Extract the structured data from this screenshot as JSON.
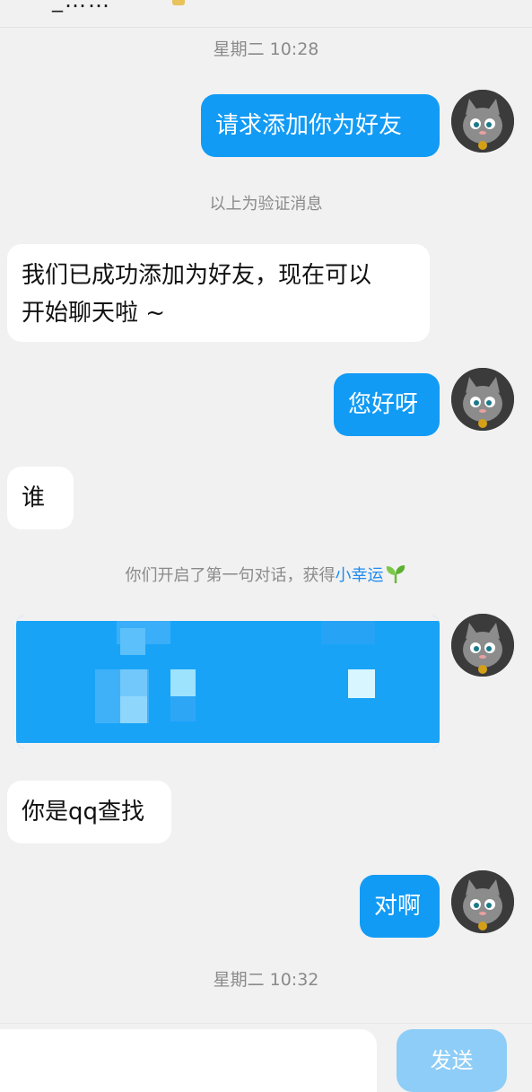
{
  "header": {
    "partial_title": "_……"
  },
  "timestamps": {
    "first": "星期二 10:28",
    "second": "星期二 10:32"
  },
  "system_notices": {
    "verify": "以上为验证消息",
    "first_chat_prefix": "你们开启了第一句对话，获得",
    "first_chat_link": "小幸运"
  },
  "messages": {
    "m1": "请求添加你为好友",
    "m2_line1": "我们已成功添加为好友，现在可以",
    "m2_line2": "开始聊天啦 ~",
    "m3": "您好呀",
    "m4": "谁",
    "m6": "你是qq查找",
    "m7": "对啊"
  },
  "input_bar": {
    "send_label": "发送"
  },
  "icons": {
    "avatar": "cat-avatar-icon",
    "leaf": "sprout-icon"
  },
  "colors": {
    "outgoing_bubble": "#129bf5",
    "incoming_bubble": "#ffffff",
    "background": "#f1f1f1",
    "link": "#1e8cf0",
    "send_disabled": "#8ecdf7"
  }
}
